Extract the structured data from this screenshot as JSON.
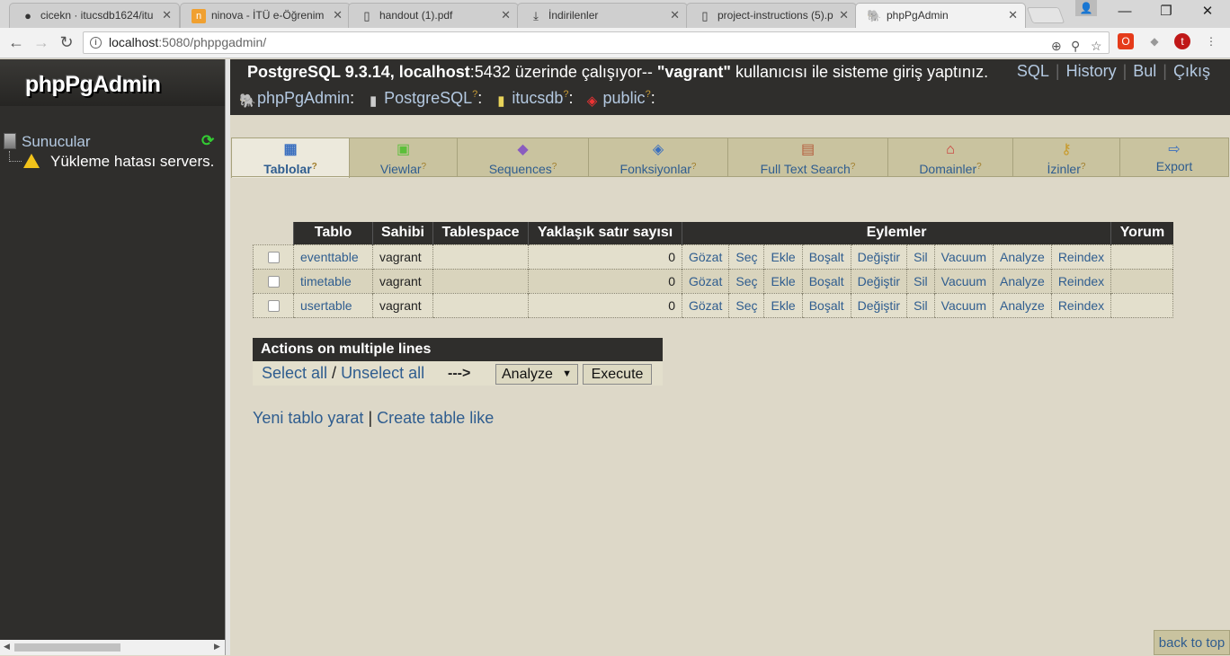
{
  "browser": {
    "tabs": [
      {
        "title": "cicekn · itucsdb1624/itu",
        "icon": "github-icon"
      },
      {
        "title": "ninova - İTÜ e-Öğrenim",
        "icon": "ninova-icon"
      },
      {
        "title": "handout (1).pdf",
        "icon": "document-icon"
      },
      {
        "title": "İndirilenler",
        "icon": "download-icon"
      },
      {
        "title": "project-instructions (5).p",
        "icon": "document-icon"
      },
      {
        "title": "phpPgAdmin",
        "icon": "elephant-icon"
      }
    ],
    "url_host": "localhost",
    "url_path": ":5080/phppgadmin/"
  },
  "sidebar": {
    "logo": "phpPgAdmin",
    "servers_label": "Sunucular",
    "error_text": "Yükleme hatası servers."
  },
  "header": {
    "server_prefix": "PostgreSQL 9.3.14, localhost",
    "server_port": ":5432 üzerinde çalışıyor-- ",
    "user": "\"vagrant\"",
    "login_suffix": " kullanıcısı ile sisteme giriş yaptınız.",
    "links": [
      "SQL",
      "History",
      "Bul",
      "Çıkış"
    ],
    "trail": [
      "phpPgAdmin",
      "PostgreSQL",
      "itucsdb",
      "public"
    ]
  },
  "tabs": [
    {
      "label": "Tablolar",
      "icon": "tables-icon"
    },
    {
      "label": "Viewlar",
      "icon": "views-icon"
    },
    {
      "label": "Sequences",
      "icon": "sequences-icon"
    },
    {
      "label": "Fonksiyonlar",
      "icon": "functions-icon"
    },
    {
      "label": "Full Text Search",
      "icon": "fulltext-icon"
    },
    {
      "label": "Domainler",
      "icon": "domains-icon"
    },
    {
      "label": "İzinler",
      "icon": "privileges-icon"
    },
    {
      "label": "Export",
      "icon": "export-icon"
    }
  ],
  "table": {
    "columns": [
      "Tablo",
      "Sahibi",
      "Tablespace",
      "Yaklaşık satır sayısı",
      "Eylemler",
      "Yorum"
    ],
    "actions": [
      "Gözat",
      "Seç",
      "Ekle",
      "Boşalt",
      "Değiştir",
      "Sil",
      "Vacuum",
      "Analyze",
      "Reindex"
    ],
    "rows": [
      {
        "name": "eventtable",
        "owner": "vagrant",
        "tablespace": "",
        "rows": "0",
        "comment": ""
      },
      {
        "name": "timetable",
        "owner": "vagrant",
        "tablespace": "",
        "rows": "0",
        "comment": ""
      },
      {
        "name": "usertable",
        "owner": "vagrant",
        "tablespace": "",
        "rows": "0",
        "comment": ""
      }
    ]
  },
  "multi": {
    "title": "Actions on multiple lines",
    "select_all": "Select all",
    "slash": " / ",
    "unselect_all": "Unselect all",
    "arrow": "--->",
    "selected_action": "Analyze",
    "execute": "Execute"
  },
  "create": {
    "new_table": "Yeni tablo yarat",
    "create_like": "Create table like"
  },
  "back_to_top": "back to top"
}
